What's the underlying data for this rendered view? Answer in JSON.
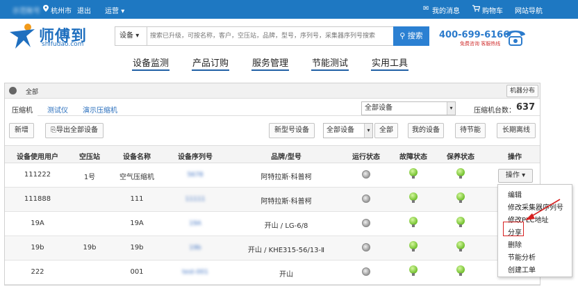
{
  "topbar": {
    "user": "示范账号",
    "city": "杭州市",
    "logout": "退出",
    "ops_menu": "运营",
    "messages": "我的消息",
    "cart": "购物车",
    "site_nav": "网站导航"
  },
  "brand": {
    "name": "师傅到",
    "domain": "shifudao.com"
  },
  "search": {
    "type_label": "设备",
    "placeholder": "搜索已升级，可按名称，客户，空压站，品牌，型号，序列号，采集器序列号搜索",
    "button": "搜索"
  },
  "hotline": {
    "number": "400-699-6166",
    "sub": "免费咨询  客服热线"
  },
  "main_nav": [
    "设备监测",
    "产品订购",
    "服务管理",
    "节能测试",
    "实用工具"
  ],
  "panel": {
    "breadcrumb": "全部",
    "distribution_button": "机器分布",
    "tabs": [
      "压缩机",
      "测试仪",
      "演示压缩机"
    ],
    "device_filter": "全部设备",
    "count_label": "压缩机台数：",
    "count_value": "637",
    "toolbar": {
      "add": "新增",
      "export": "导出全部设备",
      "new_model": "新型号设备",
      "filter_select": "全部设备",
      "all": "全部",
      "my_devices": "我的设备",
      "pending_saving": "待节能",
      "long_offline": "长期离线"
    }
  },
  "table": {
    "columns": [
      "设备使用用户",
      "空压站",
      "设备名称",
      "设备序列号",
      "品牌/型号",
      "运行状态",
      "故障状态",
      "保养状态",
      "操作"
    ],
    "rows": [
      {
        "user": "111222",
        "station": "1号",
        "name": "空气压缩机",
        "serial": "5678",
        "brand": "阿特拉斯·科普柯"
      },
      {
        "user": "111888",
        "station": "",
        "name": "111",
        "serial": "11111",
        "brand": "阿特拉斯·科普柯"
      },
      {
        "user": "19A",
        "station": "",
        "name": "19A",
        "serial": "19A",
        "brand": "开山 / LG-6/8"
      },
      {
        "user": "19b",
        "station": "19b",
        "name": "19b",
        "serial": "19b",
        "brand": "开山 / KHE315-56/13-Ⅱ"
      },
      {
        "user": "222",
        "station": "",
        "name": "001",
        "serial": "test-001",
        "brand": "开山"
      }
    ],
    "ops_button": "操作"
  },
  "dropdown": {
    "items": [
      "编辑",
      "修改采集器序列号",
      "修改PLC地址",
      "分享",
      "删除",
      "节能分析",
      "创建工单"
    ],
    "highlighted": "分享",
    "highlight_color": "#d62020"
  },
  "colors": {
    "topbar": "#1e78c2",
    "accent": "#2b80d2",
    "link": "#2a6fbd",
    "ok": "#6fbf2a"
  }
}
